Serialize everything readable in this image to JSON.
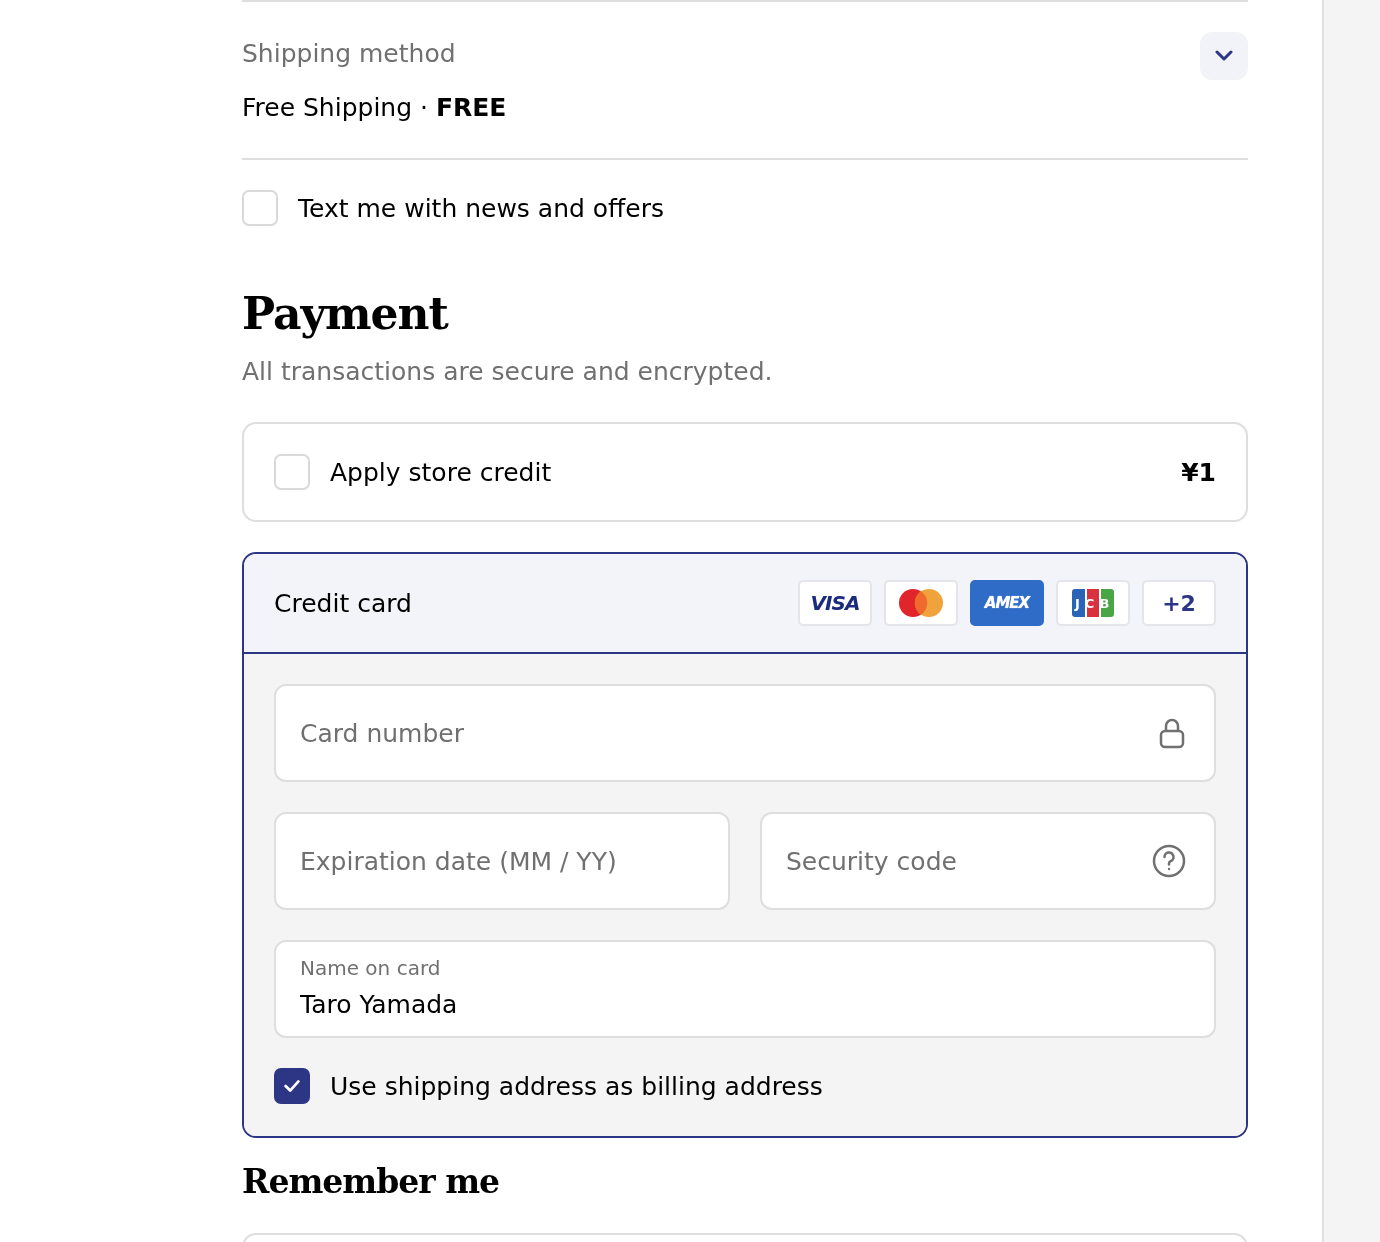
{
  "shipping_method": {
    "label": "Shipping method",
    "summary": "Free Shipping · **FREE**",
    "expanded": false
  },
  "sms_opt_in": {
    "label": "Text me with news and offers",
    "checked": false
  },
  "payment": {
    "title": "Payment",
    "subtitle": "All transactions are secure and encrypted."
  },
  "store_credit": {
    "label": "Apply store credit",
    "amount": "¥1",
    "checked": false
  },
  "payment_method": {
    "label": "Credit card",
    "selected": true,
    "card_brands": [
      {
        "kind": "visa",
        "label": "VISA"
      },
      {
        "kind": "mastercard"
      },
      {
        "kind": "amex",
        "label": "AMEX"
      },
      {
        "kind": "jcb",
        "label": "JCB"
      },
      {
        "kind": "more",
        "label": "+2"
      }
    ],
    "card_number": {
      "placeholder": "Card number"
    },
    "expiration": {
      "placeholder": "Expiration date (MM / YY)"
    },
    "security_code": {
      "placeholder": "Security code"
    },
    "name_on_card": {
      "label": "Name on card",
      "value": "Taro Yamada"
    },
    "billing_same": {
      "label": "Use shipping address as billing address",
      "checked": true
    }
  },
  "remember_me": {
    "title": "Remember me"
  }
}
